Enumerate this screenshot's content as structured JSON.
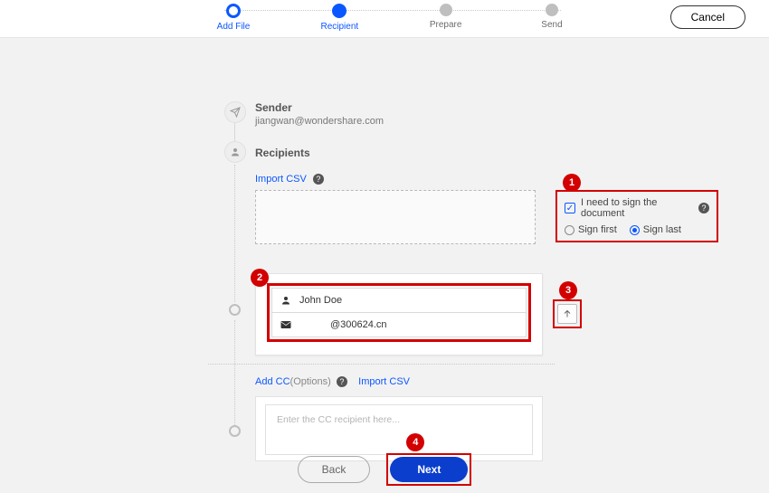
{
  "topbar": {
    "steps": [
      {
        "label": "Add File",
        "state": "active"
      },
      {
        "label": "Recipient",
        "state": "current"
      },
      {
        "label": "Prepare",
        "state": "idle"
      },
      {
        "label": "Send",
        "state": "idle"
      }
    ],
    "cancel": "Cancel"
  },
  "sender": {
    "title": "Sender",
    "email": "jiangwan@wondershare.com"
  },
  "recipients": {
    "title": "Recipients",
    "import_label": "Import CSV"
  },
  "sign_options": {
    "need_sign": "I need to sign the document",
    "sign_first": "Sign first",
    "sign_last": "Sign last"
  },
  "recipient_card": {
    "name": "John Doe",
    "email": "@300624.cn"
  },
  "cc": {
    "add_cc": "Add CC",
    "options_suffix": "(Options)",
    "import_label": "Import CSV",
    "placeholder": "Enter the CC recipient here..."
  },
  "footer": {
    "back": "Back",
    "next": "Next"
  },
  "markers": {
    "m1": "1",
    "m2": "2",
    "m3": "3",
    "m4": "4"
  }
}
